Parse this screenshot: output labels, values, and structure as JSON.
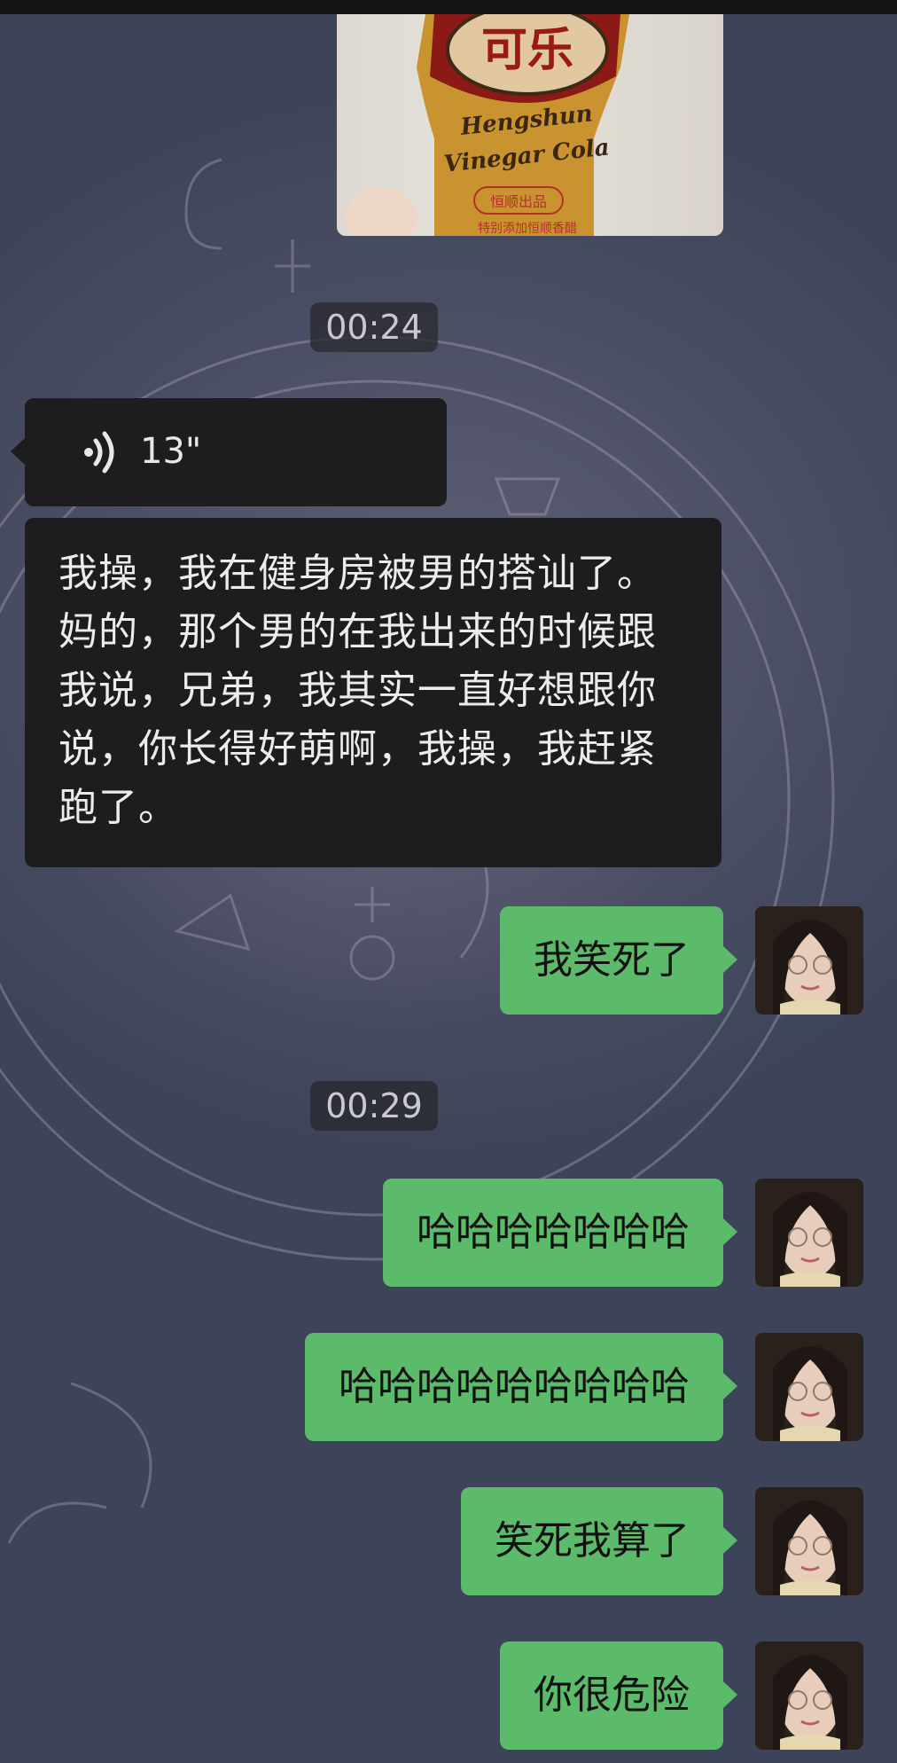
{
  "photo": {
    "product_text_top": "可乐",
    "product_text_line1": "Hengshun",
    "product_text_line2": "Vinegar Cola",
    "product_badge": "恒顺出品",
    "product_small": "特别添加恒顺香醋"
  },
  "timestamps": [
    "00:24",
    "00:29"
  ],
  "voice_message": {
    "duration": "13\""
  },
  "incoming_text": "我操，我在健身房被男的搭讪了。妈的，那个男的在我出来的时候跟我说，兄弟，我其实一直好想跟你说，你长得好萌啊，我操，我赶紧跑了。",
  "outgoing_messages": [
    "我笑死了",
    "哈哈哈哈哈哈哈",
    "哈哈哈哈哈哈哈哈哈",
    "笑死我算了",
    "你很危险"
  ],
  "colors": {
    "outgoing_bubble": "#5cbb6a",
    "incoming_bubble": "#1d1d1f",
    "background": "#4a4e64"
  }
}
